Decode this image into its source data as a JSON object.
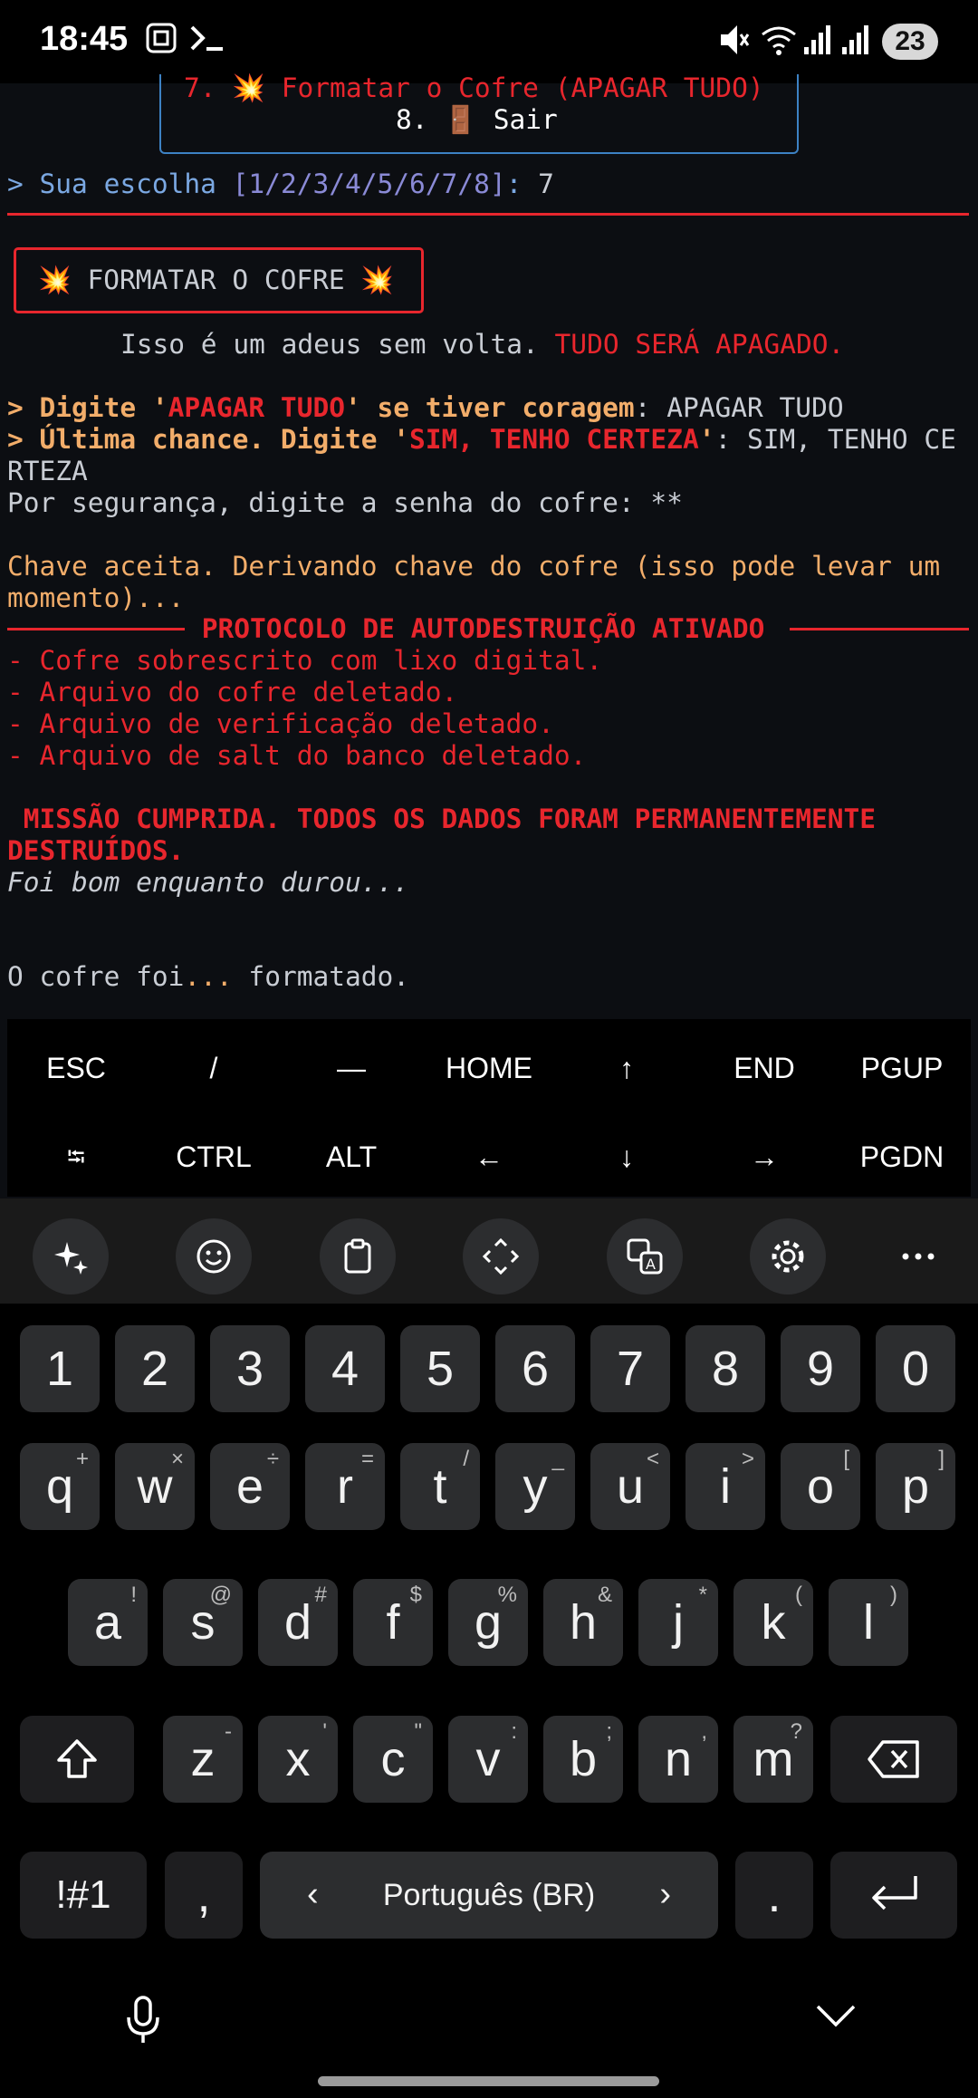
{
  "status_bar": {
    "time": "18:45",
    "battery": "23"
  },
  "terminal": {
    "menu_item_7": "7. 💥 Formatar o Cofre (APAGAR TUDO)",
    "menu_item_8": "8. 🚪 Sair",
    "choice_prompt": "> Sua escolha ",
    "choice_options": "[1/2/3/4/5/6/7/8]",
    "choice_colon": ": ",
    "choice_value": "7",
    "format_title": "💥 FORMATAR O COFRE 💥",
    "farewell_normal": "Isso é um adeus sem volta. ",
    "farewell_red": "TUDO SERÁ APAGADO.",
    "confirm1_a": "> Digite '",
    "confirm1_b": "APAGAR TUDO",
    "confirm1_c": "' se tiver coragem",
    "confirm1_d": ": ",
    "confirm1_value": "APAGAR TUDO",
    "confirm2_a": "> Última chance. Digite '",
    "confirm2_b": "SIM, TENHO CERTEZA",
    "confirm2_c": "'",
    "confirm2_d": ": ",
    "confirm2_value": "SIM, TENHO CE",
    "confirm2_wrap": "RTEZA",
    "password_prompt": "Por segurança, digite a senha do cofre: **",
    "key_accepted_1": "Chave aceita. Derivando chave do cofre (isso pode levar um",
    "key_accepted_2": "momento)...",
    "protocol_title": " PROTOCOLO DE AUTODESTRUIÇÃO ATIVADO ",
    "log_lines": [
      "- Cofre sobrescrito com lixo digital.",
      "- Arquivo do cofre deletado.",
      "- Arquivo de verificação deletado.",
      "- Arquivo de salt do banco deletado."
    ],
    "mission_1": " MISSÃO CUMPRIDA. TODOS OS DADOS FORAM PERMANENTEMENTE",
    "mission_2": "DESTRUÍDOS.",
    "goodbye": "Foi bom enquanto durou...",
    "final_a": "O cofre foi",
    "final_b": "...",
    "final_c": " formatado."
  },
  "extra_keys": {
    "row1": [
      "ESC",
      "/",
      "—",
      "HOME",
      "↑",
      "END",
      "PGUP"
    ],
    "row2": [
      "⭾",
      "CTRL",
      "ALT",
      "←",
      "↓",
      "→",
      "PGDN"
    ]
  },
  "keyboard": {
    "toolbar_icons": [
      "ai-sparkle-icon",
      "emoji-icon",
      "clipboard-icon",
      "text-cursor-move-icon",
      "translate-icon",
      "settings-gear-icon",
      "more-icon"
    ],
    "number_row": [
      "1",
      "2",
      "3",
      "4",
      "5",
      "6",
      "7",
      "8",
      "9",
      "0"
    ],
    "row_q": [
      {
        "main": "q",
        "sub": "+"
      },
      {
        "main": "w",
        "sub": "×"
      },
      {
        "main": "e",
        "sub": "÷"
      },
      {
        "main": "r",
        "sub": "="
      },
      {
        "main": "t",
        "sub": "/"
      },
      {
        "main": "y",
        "sub": "_"
      },
      {
        "main": "u",
        "sub": "<"
      },
      {
        "main": "i",
        "sub": ">"
      },
      {
        "main": "o",
        "sub": "["
      },
      {
        "main": "p",
        "sub": "]"
      }
    ],
    "row_a": [
      {
        "main": "a",
        "sub": "!"
      },
      {
        "main": "s",
        "sub": "@"
      },
      {
        "main": "d",
        "sub": "#"
      },
      {
        "main": "f",
        "sub": "$"
      },
      {
        "main": "g",
        "sub": "%"
      },
      {
        "main": "h",
        "sub": "&"
      },
      {
        "main": "j",
        "sub": "*"
      },
      {
        "main": "k",
        "sub": "("
      },
      {
        "main": "l",
        "sub": ")"
      }
    ],
    "row_z": [
      {
        "main": "z",
        "sub": "-"
      },
      {
        "main": "x",
        "sub": "'"
      },
      {
        "main": "c",
        "sub": "\""
      },
      {
        "main": "v",
        "sub": ":"
      },
      {
        "main": "b",
        "sub": ";"
      },
      {
        "main": "n",
        "sub": ","
      },
      {
        "main": "m",
        "sub": "?"
      }
    ],
    "symbols_key": "!#1",
    "comma_key": ",",
    "space_label": "Português (BR)",
    "period_key": "."
  }
}
